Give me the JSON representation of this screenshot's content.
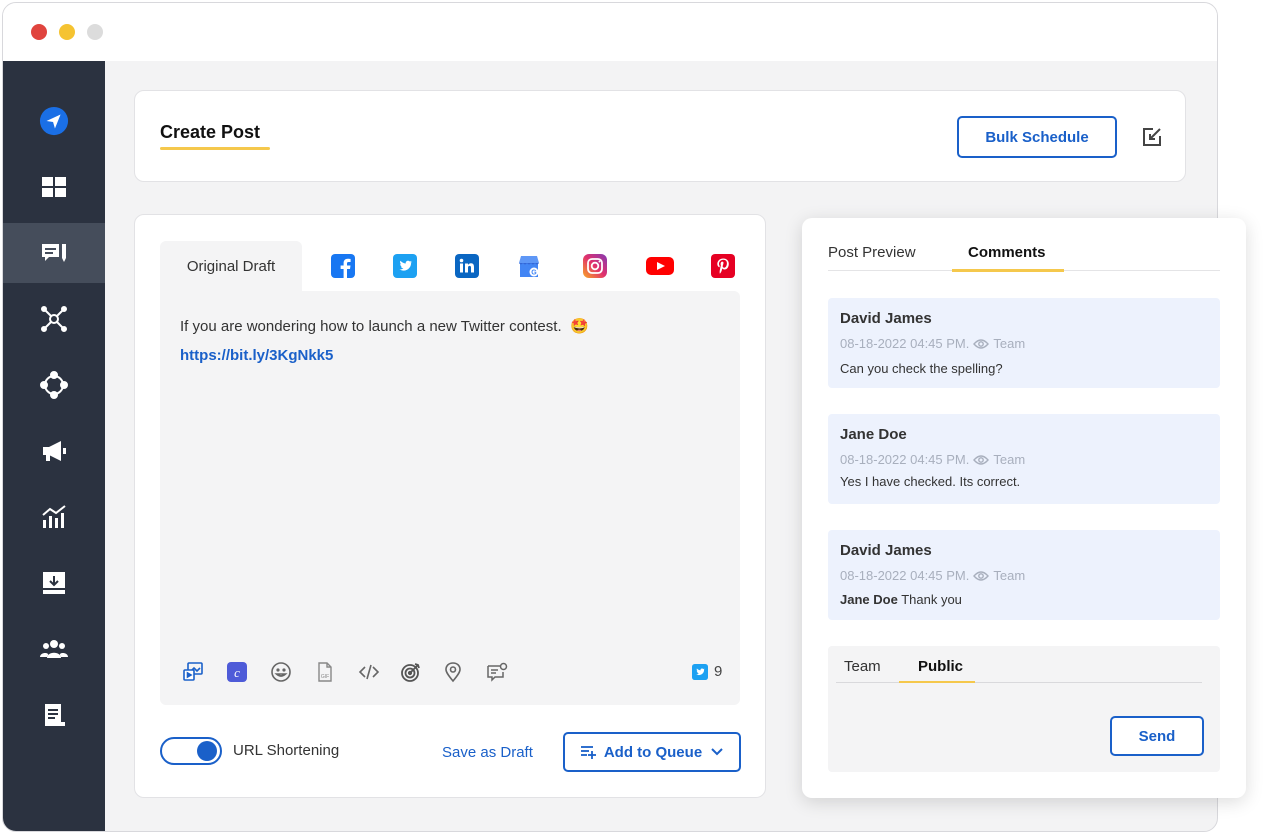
{
  "colors": {
    "accent": "#1a60c9",
    "sidebar": "#2b3240",
    "sidebar_active": "#454d5b",
    "highlight": "#f5c84c",
    "comment_bg": "#edf2fd"
  },
  "window_controls": [
    "close",
    "minimize",
    "maximize"
  ],
  "sidebar": {
    "items": [
      {
        "icon": "paper-plane-logo-icon"
      },
      {
        "icon": "dashboard-icon"
      },
      {
        "icon": "posts-icon",
        "active": true
      },
      {
        "icon": "network-icon"
      },
      {
        "icon": "hub-icon"
      },
      {
        "icon": "megaphone-icon"
      },
      {
        "icon": "analytics-icon"
      },
      {
        "icon": "inbox-download-icon"
      },
      {
        "icon": "team-icon"
      },
      {
        "icon": "document-icon"
      }
    ]
  },
  "header": {
    "title": "Create Post",
    "bulk_label": "Bulk Schedule"
  },
  "editor": {
    "tab_original": "Original Draft",
    "networks": [
      "facebook",
      "twitter",
      "linkedin",
      "google-business",
      "instagram",
      "youtube",
      "pinterest"
    ],
    "post_text": "If you are wondering how to launch a new Twitter contest.",
    "post_emoji": "🤩",
    "post_link": "https://bit.ly/3KgNkk5",
    "tools": [
      "media-icon",
      "canva-icon",
      "emoji-icon",
      "gif-icon",
      "code-icon",
      "target-icon",
      "location-icon",
      "comment-tool-icon"
    ],
    "char_count": "9"
  },
  "footer": {
    "url_shortening_label": "URL Shortening",
    "url_shortening_on": true,
    "save_draft": "Save as Draft",
    "add_queue": "Add to Queue"
  },
  "panel": {
    "tab_preview": "Post Preview",
    "tab_comments": "Comments",
    "comments": [
      {
        "author": "David James",
        "date": "08-18-2022 04:45 PM.",
        "visibility": "Team",
        "mention": "",
        "text": "Can you check the spelling?"
      },
      {
        "author": "Jane Doe",
        "date": "08-18-2022 04:45 PM.",
        "visibility": "Team",
        "mention": "",
        "text": "Yes I have checked. Its correct."
      },
      {
        "author": "David James",
        "date": "08-18-2022 04:45 PM.",
        "visibility": "Team",
        "mention": "Jane Doe",
        "text": "Thank you"
      }
    ],
    "reply": {
      "tab_team": "Team",
      "tab_public": "Public",
      "send": "Send"
    }
  }
}
